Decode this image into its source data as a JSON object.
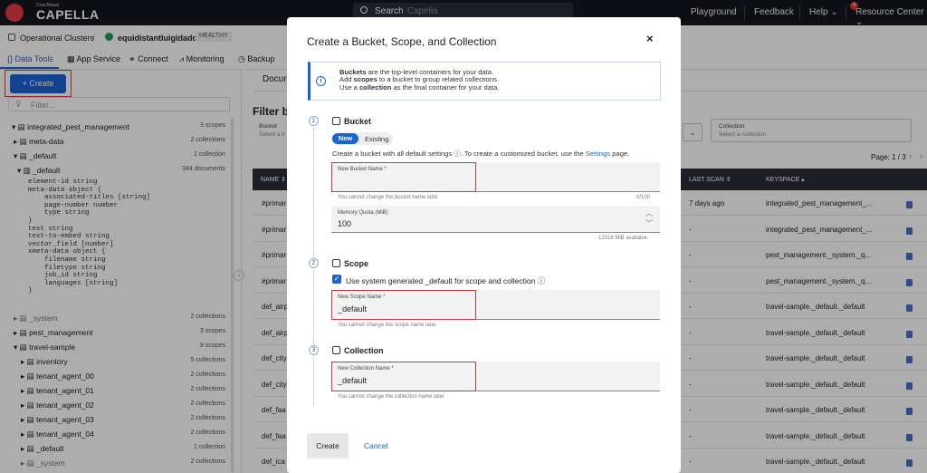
{
  "topbar": {
    "logo_small": "Couchbase",
    "logo_text": "CAPELLA",
    "search_label": "Search",
    "search_placeholder": "Capella",
    "nav": [
      "Playground",
      "Feedback",
      "Help",
      "Resource Center"
    ],
    "badge": "4"
  },
  "breadcrumb": {
    "root": "Operational Clusters",
    "sep": "/",
    "cluster": "equidistantluigidadda",
    "status": "HEALTHY"
  },
  "tabs": [
    "Data Tools",
    "App Service",
    "Connect",
    "Monitoring",
    "Backup"
  ],
  "left": {
    "create_label": "+ Create",
    "filter_placeholder": "Filter...",
    "tree_top": [
      {
        "label": "integrated_pest_management",
        "count": "3 scopes"
      },
      {
        "label": "meta-data",
        "count": "2 collections"
      },
      {
        "label": "_default",
        "count": "1 collection"
      },
      {
        "label": "_default",
        "count": "344 documents"
      }
    ],
    "schema": "element-id string\nmeta-data object {\n    associated-titles [string]\n    page-number number\n    type string\n}\ntext string\ntext-to-embed string\nvector_field [number]\nxmeta-data object {\n    filename string\n    filetype string\n    job_id string\n    languages [string]\n}",
    "tree_bottom": [
      {
        "label": "_system",
        "count": "2 collections"
      },
      {
        "label": "pest_management",
        "count": "3 scopes"
      },
      {
        "label": "travel-sample",
        "count": "8 scopes"
      },
      {
        "label": "inventory",
        "count": "5 collections"
      },
      {
        "label": "tenant_agent_00",
        "count": "2 collections"
      },
      {
        "label": "tenant_agent_01",
        "count": "2 collections"
      },
      {
        "label": "tenant_agent_02",
        "count": "2 collections"
      },
      {
        "label": "tenant_agent_03",
        "count": "2 collections"
      },
      {
        "label": "tenant_agent_04",
        "count": "2 collections"
      },
      {
        "label": "_default",
        "count": "1 collection"
      },
      {
        "label": "_system",
        "count": "2 collections"
      }
    ]
  },
  "main": {
    "tab": "Docum",
    "filter_title": "Filter by",
    "bucket_label": "Bucket",
    "bucket_ph": "Select a b",
    "collection_label": "Collection",
    "collection_ph": "Select a collection",
    "page": "Page: 1 / 3",
    "col_name": "NAME",
    "col_scan": "LAST SCAN",
    "col_keyspace": "KEYSPACE",
    "rows": [
      {
        "name": "#primar",
        "scan": "7 days ago",
        "ks": "integrated_pest_management_..."
      },
      {
        "name": "#primar",
        "scan": "-",
        "ks": "integrated_pest_management_..."
      },
      {
        "name": "#primar",
        "scan": "-",
        "ks": "pest_management._system._q..."
      },
      {
        "name": "#primar",
        "scan": "-",
        "ks": "pest_management._system._q..."
      },
      {
        "name": "def_airp",
        "scan": "-",
        "ks": "travel-sample._default._default"
      },
      {
        "name": "def_airp",
        "scan": "-",
        "ks": "travel-sample._default._default"
      },
      {
        "name": "def_city",
        "scan": "-",
        "ks": "travel-sample._default._default"
      },
      {
        "name": "def_city",
        "scan": "-",
        "ks": "travel-sample._default._default"
      },
      {
        "name": "def_faa",
        "scan": "-",
        "ks": "travel-sample._default._default"
      },
      {
        "name": "def_faa",
        "scan": "-",
        "ks": "travel-sample._default._default"
      },
      {
        "name": "def_ica",
        "scan": "-",
        "ks": "travel-sample._default._default"
      }
    ]
  },
  "modal": {
    "title": "Create a Bucket, Scope, and Collection",
    "close": "×",
    "info_1a": "Buckets",
    "info_1b": " are the top-level containers for your data.",
    "info_2a": "Add ",
    "info_2b": "scopes",
    "info_2c": " to a bucket to group related collections.",
    "info_3a": "Use a ",
    "info_3b": "collection",
    "info_3c": " as the final container for your data.",
    "step1": "1",
    "step2": "2",
    "step3": "3",
    "bucket_head": "Bucket",
    "seg_new": "New",
    "seg_existing": "Existing",
    "bucket_desc": "Create a bucket with all default settings ⓘ. To create a customized bucket, use the ",
    "bucket_desc_link": "Settings",
    "bucket_desc_end": " page.",
    "bucket_name_label": "New Bucket Name *",
    "bucket_name_hint": "You cannot change the bucket name later",
    "bucket_name_count": "0/100",
    "memory_label": "Memory Quota (MiB)",
    "memory_value": "100",
    "memory_avail": "12018 MiB available",
    "scope_head": "Scope",
    "scope_checkbox": "Use system generated _default for scope and collection ⓘ",
    "scope_name_label": "New Scope Name *",
    "scope_name_value": "_default",
    "scope_name_hint": "You cannot change the scope name later",
    "collection_head": "Collection",
    "collection_name_label": "New Collection Name *",
    "collection_name_value": "_default",
    "collection_name_hint": "You cannot change the collection name later",
    "create_label": "Create",
    "cancel_label": "Cancel"
  }
}
